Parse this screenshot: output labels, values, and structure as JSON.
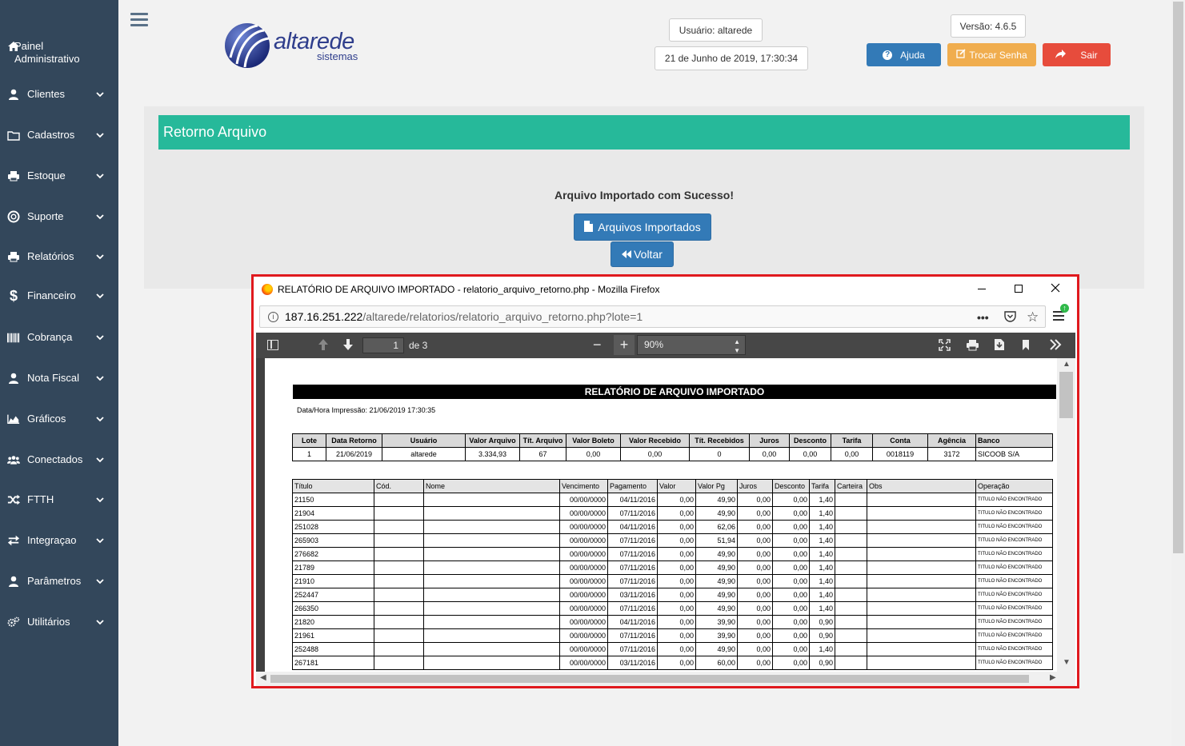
{
  "sidebar": {
    "items": [
      {
        "label": "Painel Administrativo",
        "icon": "home-icon"
      },
      {
        "label": "Clientes",
        "icon": "user-icon"
      },
      {
        "label": "Cadastros",
        "icon": "folder-icon"
      },
      {
        "label": "Estoque",
        "icon": "printer-icon"
      },
      {
        "label": "Suporte",
        "icon": "lifebuoy-icon"
      },
      {
        "label": "Relatórios",
        "icon": "printer-icon"
      },
      {
        "label": "Financeiro",
        "icon": "dollar-icon"
      },
      {
        "label": "Cobrança",
        "icon": "barcode-icon"
      },
      {
        "label": "Nota Fiscal",
        "icon": "user-icon"
      },
      {
        "label": "Gráficos",
        "icon": "area-chart-icon"
      },
      {
        "label": "Conectados",
        "icon": "users-icon"
      },
      {
        "label": "FTTH",
        "icon": "shuffle-icon"
      },
      {
        "label": "Integraçao",
        "icon": "exchange-icon"
      },
      {
        "label": "Parâmetros",
        "icon": "user-icon"
      },
      {
        "label": "Utilitários",
        "icon": "cogs-icon"
      }
    ]
  },
  "header": {
    "logo_word": "altarede",
    "logo_sub": "sistemas",
    "user": "Usuário: altarede",
    "datetime": "21 de Junho de 2019, 17:30:34",
    "version": "Versão: 4.6.5",
    "help_label": "Ajuda",
    "change_password_label": "Trocar Senha",
    "logout_label": "Sair"
  },
  "main": {
    "title": "Retorno Arquivo",
    "success_message": "Arquivo Importado com Sucesso!",
    "imported_files_label": "Arquivos Importados",
    "back_label": "Voltar"
  },
  "firefox": {
    "window_title": "RELATÓRIO DE ARQUIVO IMPORTADO - relatorio_arquivo_retorno.php - Mozilla Firefox",
    "url_host": "187.16.251.222",
    "url_path": "/altarede/relatorios/relatorio_arquivo_retorno.php?lote=1",
    "page_number": "1",
    "page_total": "de 3",
    "zoom": "90%"
  },
  "report": {
    "title": "RELATÓRIO DE ARQUIVO IMPORTADO",
    "print_datetime": "Data/Hora Impressão: 21/06/2019 17:30:35",
    "summary_headers": [
      "Lote",
      "Data Retorno",
      "Usuário",
      "Valor Arquivo",
      "Tít. Arquivo",
      "Valor Boleto",
      "Valor Recebido",
      "Tít. Recebidos",
      "Juros",
      "Desconto",
      "Tarifa",
      "Conta",
      "Agência",
      "Banco"
    ],
    "summary_row": [
      "1",
      "21/06/2019",
      "altarede",
      "3.334,93",
      "67",
      "0,00",
      "0,00",
      "0",
      "0,00",
      "0,00",
      "0,00",
      "0018119",
      "3172",
      "SICOOB S/A"
    ],
    "detail_headers": [
      "Título",
      "Cód.",
      "Nome",
      "Vencimento",
      "Pagamento",
      "Valor",
      "Valor Pg",
      "Juros",
      "Desconto",
      "Tarifa",
      "Carteira",
      "Obs",
      "Operação"
    ],
    "detail_rows": [
      [
        "21150",
        "",
        "",
        "00/00/0000",
        "04/11/2016",
        "0,00",
        "49,90",
        "0,00",
        "0,00",
        "1,40",
        "",
        "",
        "TITULO NÃO ENCONTRADO"
      ],
      [
        "21904",
        "",
        "",
        "00/00/0000",
        "07/11/2016",
        "0,00",
        "49,90",
        "0,00",
        "0,00",
        "1,40",
        "",
        "",
        "TITULO NÃO ENCONTRADO"
      ],
      [
        "251028",
        "",
        "",
        "00/00/0000",
        "04/11/2016",
        "0,00",
        "62,06",
        "0,00",
        "0,00",
        "1,40",
        "",
        "",
        "TITULO NÃO ENCONTRADO"
      ],
      [
        "265903",
        "",
        "",
        "00/00/0000",
        "07/11/2016",
        "0,00",
        "51,94",
        "0,00",
        "0,00",
        "1,40",
        "",
        "",
        "TITULO NÃO ENCONTRADO"
      ],
      [
        "276682",
        "",
        "",
        "00/00/0000",
        "07/11/2016",
        "0,00",
        "49,90",
        "0,00",
        "0,00",
        "1,40",
        "",
        "",
        "TITULO NÃO ENCONTRADO"
      ],
      [
        "21789",
        "",
        "",
        "00/00/0000",
        "07/11/2016",
        "0,00",
        "49,90",
        "0,00",
        "0,00",
        "1,40",
        "",
        "",
        "TITULO NÃO ENCONTRADO"
      ],
      [
        "21910",
        "",
        "",
        "00/00/0000",
        "07/11/2016",
        "0,00",
        "49,90",
        "0,00",
        "0,00",
        "1,40",
        "",
        "",
        "TITULO NÃO ENCONTRADO"
      ],
      [
        "252447",
        "",
        "",
        "00/00/0000",
        "03/11/2016",
        "0,00",
        "49,90",
        "0,00",
        "0,00",
        "1,40",
        "",
        "",
        "TITULO NÃO ENCONTRADO"
      ],
      [
        "266350",
        "",
        "",
        "00/00/0000",
        "07/11/2016",
        "0,00",
        "49,90",
        "0,00",
        "0,00",
        "1,40",
        "",
        "",
        "TITULO NÃO ENCONTRADO"
      ],
      [
        "21820",
        "",
        "",
        "00/00/0000",
        "04/11/2016",
        "0,00",
        "39,90",
        "0,00",
        "0,00",
        "0,90",
        "",
        "",
        "TITULO NÃO ENCONTRADO"
      ],
      [
        "21961",
        "",
        "",
        "00/00/0000",
        "07/11/2016",
        "0,00",
        "39,90",
        "0,00",
        "0,00",
        "0,90",
        "",
        "",
        "TITULO NÃO ENCONTRADO"
      ],
      [
        "252488",
        "",
        "",
        "00/00/0000",
        "07/11/2016",
        "0,00",
        "49,90",
        "0,00",
        "0,00",
        "1,40",
        "",
        "",
        "TITULO NÃO ENCONTRADO"
      ],
      [
        "267181",
        "",
        "",
        "00/00/0000",
        "03/11/2016",
        "0,00",
        "60,00",
        "0,00",
        "0,00",
        "0,90",
        "",
        "",
        "TITULO NÃO ENCONTRADO"
      ]
    ]
  },
  "colors": {
    "sidebar": "#33475b",
    "header_green": "#26b99a",
    "help": "#337ab7",
    "change_password": "#f0ad4e",
    "logout": "#e74c3c",
    "highlight": "#e0191e"
  }
}
